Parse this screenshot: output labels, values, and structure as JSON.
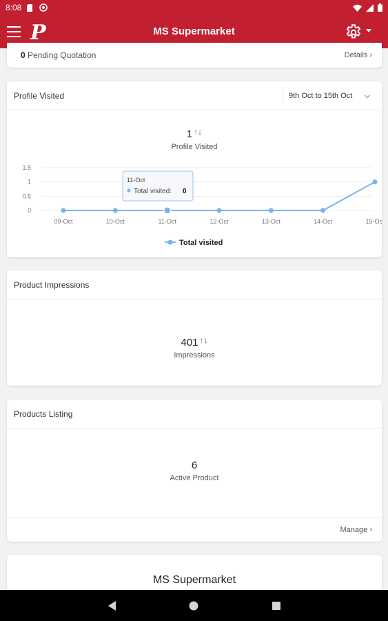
{
  "status_bar": {
    "time": "8:08"
  },
  "app_bar": {
    "logo": "P",
    "title": "MS Supermarket"
  },
  "pending": {
    "count": "0",
    "label": "Pending Quotation",
    "details": "Details ›"
  },
  "profile": {
    "title": "Profile Visited",
    "date_range": "9th Oct to 15th Oct",
    "value": "1",
    "label": "Profile Visited",
    "tooltip_date": "11-Oct",
    "tooltip_label": "Total visited:",
    "tooltip_value": "0",
    "legend": "Total visited"
  },
  "chart_data": {
    "type": "line",
    "categories": [
      "09-Oct",
      "10-Oct",
      "11-Oct",
      "12-Oct",
      "13-Oct",
      "14-Oct",
      "15-Oct"
    ],
    "series": [
      {
        "name": "Total visited",
        "values": [
          0,
          0,
          0,
          0,
          0,
          0,
          1
        ]
      }
    ],
    "yticks": [
      "1.5",
      "1",
      "0.5",
      "0"
    ],
    "ylim": [
      0,
      1.5
    ],
    "grid": true,
    "legend_position": "bottom",
    "line_color": "#7bb3e9"
  },
  "impressions": {
    "title": "Product Impressions",
    "value": "401",
    "label": "Impressions"
  },
  "listing": {
    "title": "Products Listing",
    "value": "6",
    "label": "Active Product",
    "manage": "Manage ›"
  },
  "store": {
    "name": "MS Supermarket"
  },
  "colors": {
    "brand_red": "#c21f30",
    "up_green": "#2e9e3e",
    "down_red": "#d11a2a"
  }
}
